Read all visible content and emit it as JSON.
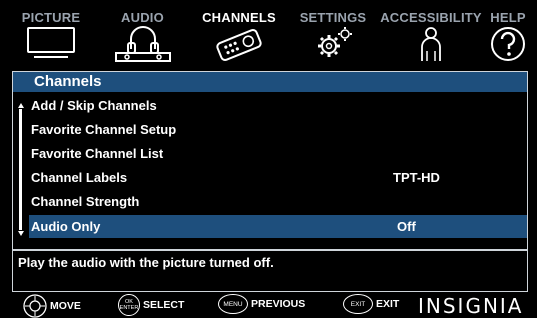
{
  "tabs": [
    {
      "label": "PICTURE",
      "icon": "tv-icon"
    },
    {
      "label": "AUDIO",
      "icon": "headphones-icon"
    },
    {
      "label": "CHANNELS",
      "icon": "remote-icon",
      "active": true
    },
    {
      "label": "SETTINGS",
      "icon": "gears-icon"
    },
    {
      "label": "ACCESSIBILITY",
      "icon": "person-icon"
    },
    {
      "label": "HELP",
      "icon": "help-icon"
    }
  ],
  "panel": {
    "title": "Channels",
    "items": [
      {
        "label": "Add / Skip Channels",
        "value": ""
      },
      {
        "label": "Favorite Channel Setup",
        "value": ""
      },
      {
        "label": "Favorite Channel List",
        "value": ""
      },
      {
        "label": "Channel Labels",
        "value": "TPT-HD"
      },
      {
        "label": "Channel Strength",
        "value": ""
      },
      {
        "label": "Audio Only",
        "value": "Off",
        "selected": true
      }
    ],
    "description": "Play the audio with the picture turned off."
  },
  "footer": {
    "keys": [
      {
        "button": "",
        "label": "MOVE"
      },
      {
        "button": "OK ENTER",
        "label": "SELECT"
      },
      {
        "button": "MENU",
        "label": "PREVIOUS"
      },
      {
        "button": "EXIT",
        "label": "EXIT"
      }
    ],
    "brand": "INSIGNIA"
  },
  "colors": {
    "highlight": "#1e4f7d",
    "inactive_tab": "#9aa3ae",
    "background": "#000000"
  }
}
